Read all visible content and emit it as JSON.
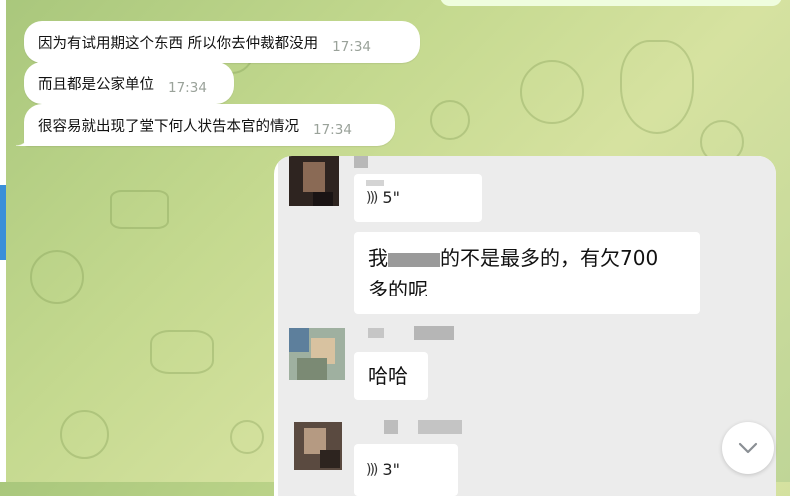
{
  "messages": [
    {
      "text": "因为有试用期这个东西  所以你去仲裁都没用",
      "time": "17:34"
    },
    {
      "text": "而且都是公家单位",
      "time": "17:34"
    },
    {
      "text": "很容易就出现了堂下何人状告本官的情况",
      "time": "17:34"
    }
  ],
  "screenshot": {
    "voice1_duration": "5\"",
    "text_line1_a": "我",
    "text_line1_b": "的不是最多的，有欠700",
    "text_line2": "多的呢",
    "reply": "哈哈",
    "voice2_duration": "3\""
  },
  "icons": {
    "voice": "voice-wave-icon",
    "scroll": "chevron-down-icon"
  },
  "colors": {
    "background": "#bfd597",
    "bubble": "#ffffff",
    "accent": "#3a8fd9"
  }
}
